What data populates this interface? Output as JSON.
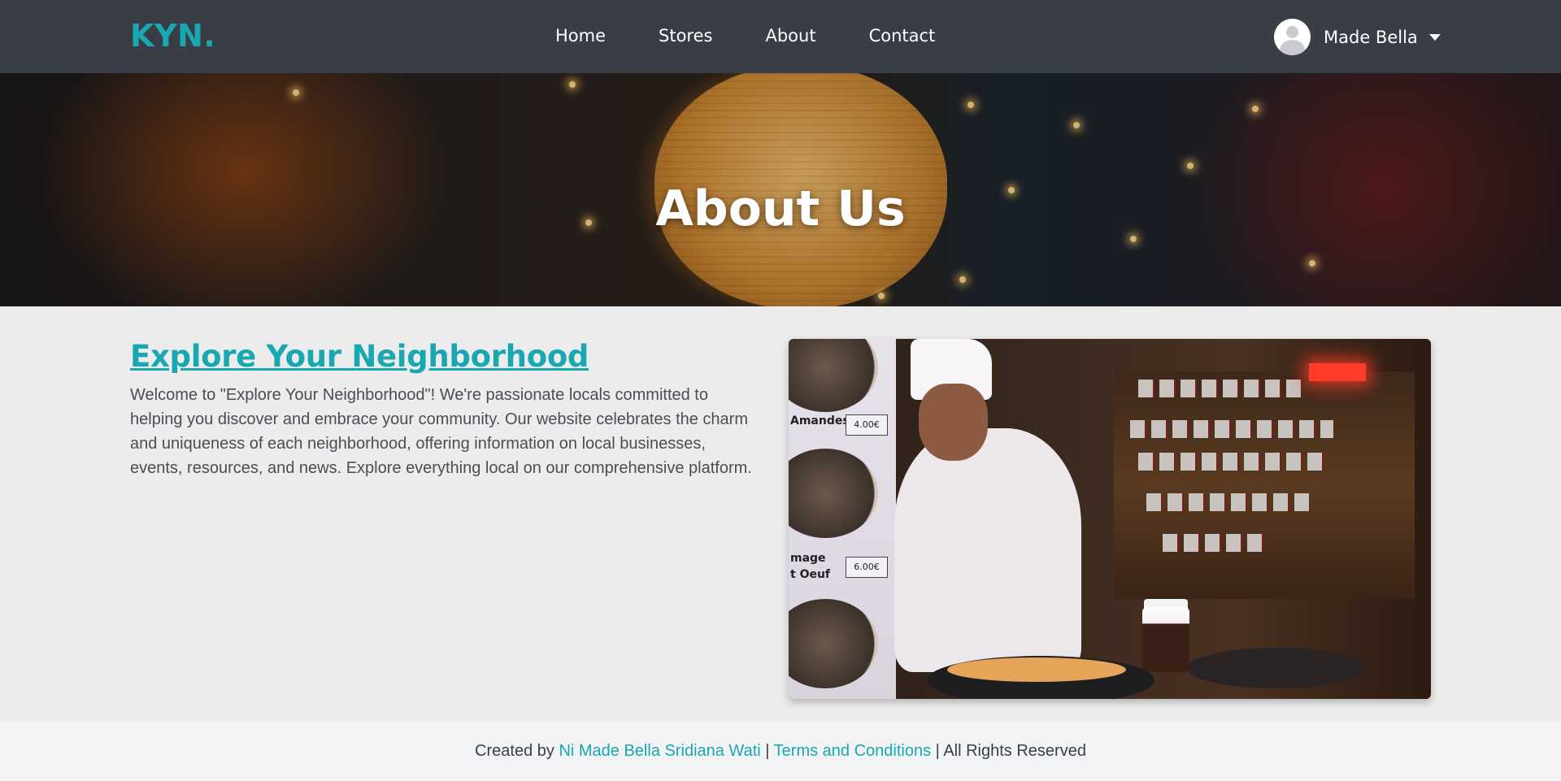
{
  "navbar": {
    "brand": "KYN.",
    "links": [
      {
        "label": "Home"
      },
      {
        "label": "Stores"
      },
      {
        "label": "About"
      },
      {
        "label": "Contact"
      }
    ],
    "user": {
      "name": "Made Bella",
      "avatar_icon": "user-avatar-icon",
      "menu_icon": "caret-down-icon"
    }
  },
  "hero": {
    "title": "About Us"
  },
  "content": {
    "title": "Explore Your Neighborhood",
    "body": "Welcome to \"Explore Your Neighborhood\"! We're passionate locals committed to helping you discover and embrace your community. Our website celebrates the charm and uniqueness of each neighborhood, offering information on local businesses, events, resources, and news. Explore everything local on our comprehensive platform.",
    "photo_menu": {
      "item1": "Amandes",
      "price1": "4.00€",
      "item2_line1": "mage",
      "item2_line2": "t Oeuf",
      "price2": "6.00€"
    }
  },
  "footer": {
    "prefix": "Created by ",
    "author": "Ni Made Bella Sridiana Wati",
    "separator1": " | ",
    "terms": "Terms and Conditions",
    "separator2": " | ",
    "rights": "All Rights Reserved"
  },
  "colors": {
    "accent": "#19a7b1",
    "navbar_bg": "#393d45",
    "page_bg": "#ececec",
    "footer_bg": "#f2f3f5"
  }
}
